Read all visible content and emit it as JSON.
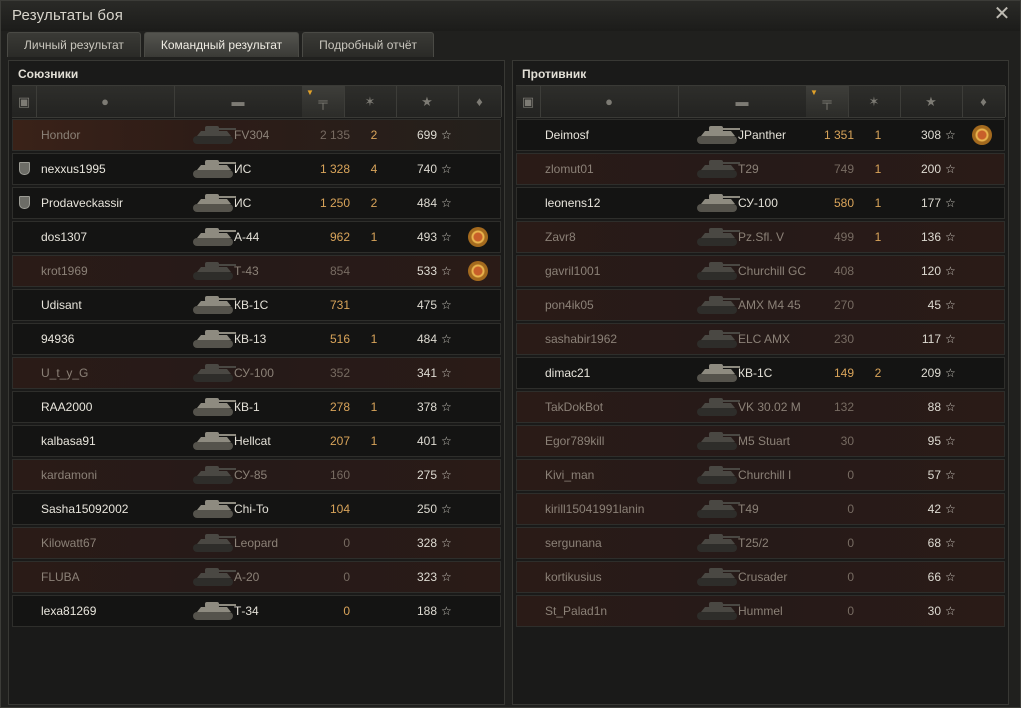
{
  "window": {
    "title": "Результаты боя",
    "close_glyph": "✕"
  },
  "tabs": [
    {
      "label": "Личный результат",
      "active": false
    },
    {
      "label": "Командный результат",
      "active": true
    },
    {
      "label": "Подробный отчёт",
      "active": false
    }
  ],
  "allies": {
    "title": "Союзники",
    "rows": [
      {
        "player": "Hondor",
        "vehicle": "FV304",
        "damage": "2 135",
        "kills": "2",
        "xp": "699",
        "dead": true,
        "platoon": false,
        "medal": false
      },
      {
        "player": "nexxus1995",
        "vehicle": "ИС",
        "damage": "1 328",
        "kills": "4",
        "xp": "740",
        "dead": false,
        "platoon": true,
        "medal": false
      },
      {
        "player": "Prodaveckassir",
        "vehicle": "ИС",
        "damage": "1 250",
        "kills": "2",
        "xp": "484",
        "dead": false,
        "platoon": true,
        "medal": false
      },
      {
        "player": "dos1307",
        "vehicle": "А-44",
        "damage": "962",
        "kills": "1",
        "xp": "493",
        "dead": false,
        "platoon": false,
        "medal": true
      },
      {
        "player": "krot1969",
        "vehicle": "Т-43",
        "damage": "854",
        "kills": "",
        "xp": "533",
        "dead": true,
        "platoon": false,
        "medal": true
      },
      {
        "player": "Udisant",
        "vehicle": "КВ-1С",
        "damage": "731",
        "kills": "",
        "xp": "475",
        "dead": false,
        "platoon": false,
        "medal": false
      },
      {
        "player": "94936",
        "vehicle": "КВ-13",
        "damage": "516",
        "kills": "1",
        "xp": "484",
        "dead": false,
        "platoon": false,
        "medal": false
      },
      {
        "player": "U_t_y_G",
        "vehicle": "СУ-100",
        "damage": "352",
        "kills": "",
        "xp": "341",
        "dead": true,
        "platoon": false,
        "medal": false
      },
      {
        "player": "RAA2000",
        "vehicle": "КВ-1",
        "damage": "278",
        "kills": "1",
        "xp": "378",
        "dead": false,
        "platoon": false,
        "medal": false
      },
      {
        "player": "kalbasa91",
        "vehicle": "Hellcat",
        "damage": "207",
        "kills": "1",
        "xp": "401",
        "dead": false,
        "platoon": false,
        "medal": false
      },
      {
        "player": "kardamoni",
        "vehicle": "СУ-85",
        "damage": "160",
        "kills": "",
        "xp": "275",
        "dead": true,
        "platoon": false,
        "medal": false
      },
      {
        "player": "Sasha15092002",
        "vehicle": "Chi-To",
        "damage": "104",
        "kills": "",
        "xp": "250",
        "dead": false,
        "platoon": false,
        "medal": false
      },
      {
        "player": "Kilowatt67",
        "vehicle": "Leopard",
        "damage": "0",
        "kills": "",
        "xp": "328",
        "dead": true,
        "platoon": false,
        "medal": false
      },
      {
        "player": "FLUBA",
        "vehicle": "А-20",
        "damage": "0",
        "kills": "",
        "xp": "323",
        "dead": true,
        "platoon": false,
        "medal": false
      },
      {
        "player": "lexa81269",
        "vehicle": "Т-34",
        "damage": "0",
        "kills": "",
        "xp": "188",
        "dead": false,
        "platoon": false,
        "medal": false
      }
    ]
  },
  "enemies": {
    "title": "Противник",
    "rows": [
      {
        "player": "Deimosf",
        "vehicle": "JPanther",
        "damage": "1 351",
        "kills": "1",
        "xp": "308",
        "dead": false,
        "platoon": false,
        "medal": true
      },
      {
        "player": "zlomut01",
        "vehicle": "T29",
        "damage": "749",
        "kills": "1",
        "xp": "200",
        "dead": true,
        "platoon": false,
        "medal": false
      },
      {
        "player": "leonens12",
        "vehicle": "СУ-100",
        "damage": "580",
        "kills": "1",
        "xp": "177",
        "dead": false,
        "platoon": false,
        "medal": false
      },
      {
        "player": "Zavr8",
        "vehicle": "Pz.Sfl. V",
        "damage": "499",
        "kills": "1",
        "xp": "136",
        "dead": true,
        "platoon": false,
        "medal": false
      },
      {
        "player": "gavril1001",
        "vehicle": "Churchill GC",
        "damage": "408",
        "kills": "",
        "xp": "120",
        "dead": true,
        "platoon": false,
        "medal": false
      },
      {
        "player": "pon4ik05",
        "vehicle": "AMX M4 45",
        "damage": "270",
        "kills": "",
        "xp": "45",
        "dead": true,
        "platoon": false,
        "medal": false
      },
      {
        "player": "sashabir1962",
        "vehicle": "ELC AMX",
        "damage": "230",
        "kills": "",
        "xp": "117",
        "dead": true,
        "platoon": false,
        "medal": false
      },
      {
        "player": "dimac21",
        "vehicle": "КВ-1С",
        "damage": "149",
        "kills": "2",
        "xp": "209",
        "dead": false,
        "platoon": false,
        "medal": false
      },
      {
        "player": "TakDokBot",
        "vehicle": "VK 30.02 M",
        "damage": "132",
        "kills": "",
        "xp": "88",
        "dead": true,
        "platoon": false,
        "medal": false
      },
      {
        "player": "Egor789kill",
        "vehicle": "M5 Stuart",
        "damage": "30",
        "kills": "",
        "xp": "95",
        "dead": true,
        "platoon": false,
        "medal": false
      },
      {
        "player": "Kivi_man",
        "vehicle": "Churchill I",
        "damage": "0",
        "kills": "",
        "xp": "57",
        "dead": true,
        "platoon": false,
        "medal": false
      },
      {
        "player": "kirill15041991lanin",
        "vehicle": "T49",
        "damage": "0",
        "kills": "",
        "xp": "42",
        "dead": true,
        "platoon": false,
        "medal": false
      },
      {
        "player": "sergunana",
        "vehicle": "T25/2",
        "damage": "0",
        "kills": "",
        "xp": "68",
        "dead": true,
        "platoon": false,
        "medal": false
      },
      {
        "player": "kortikusius",
        "vehicle": "Crusader",
        "damage": "0",
        "kills": "",
        "xp": "66",
        "dead": true,
        "platoon": false,
        "medal": false
      },
      {
        "player": "St_Palad1n",
        "vehicle": "Hummel",
        "damage": "0",
        "kills": "",
        "xp": "30",
        "dead": true,
        "platoon": false,
        "medal": false
      }
    ]
  },
  "columns": [
    "squad-icon",
    "player-icon",
    "vehicle-icon",
    "damage-icon",
    "kills-icon",
    "xp-icon",
    "medal-icon"
  ],
  "colors": {
    "damage": "#d9a45a",
    "dead_row": "#261a18",
    "accent_sort": "#e0a12a"
  }
}
